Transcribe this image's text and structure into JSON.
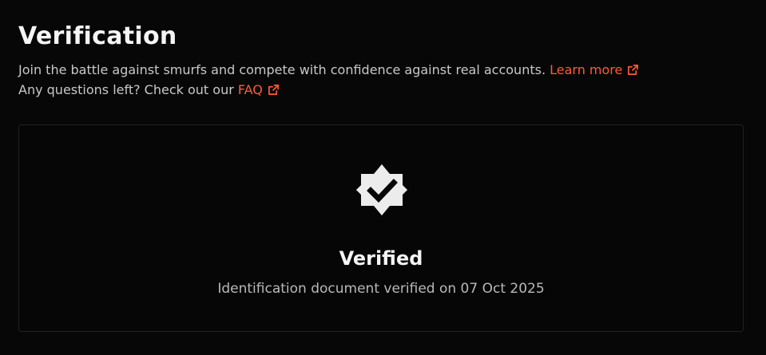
{
  "header": {
    "title": "Verification",
    "description": "Join the battle against smurfs and compete with confidence against real accounts.",
    "learn_more_label": "Learn more",
    "questions_text": "Any questions left? Check out our",
    "faq_label": "FAQ"
  },
  "card": {
    "status": "Verified",
    "detail": "Identification document verified on 07 Oct 2025"
  },
  "icons": {
    "external_link": "external-link-icon",
    "badge": "verified-badge-icon"
  },
  "colors": {
    "accent": "#ff5a36",
    "background": "#070707",
    "text_muted": "#c8c8c8"
  }
}
